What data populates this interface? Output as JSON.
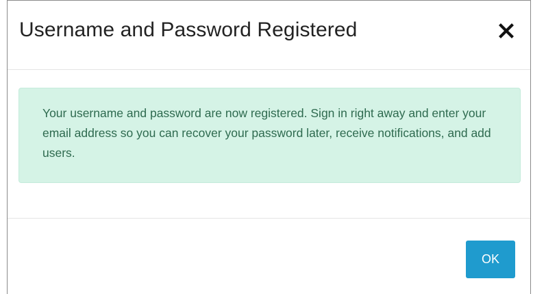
{
  "dialog": {
    "title": "Username and Password Registered",
    "close_icon": "close-icon",
    "message": "Your username and password are now registered. Sign in right away and enter your email address so you can recover your password later, receive notifications, and add users.",
    "ok_label": "OK"
  },
  "colors": {
    "alert_background": "#d5f3e6",
    "alert_text": "#2e6a4f",
    "primary_button": "#1f9bce"
  }
}
